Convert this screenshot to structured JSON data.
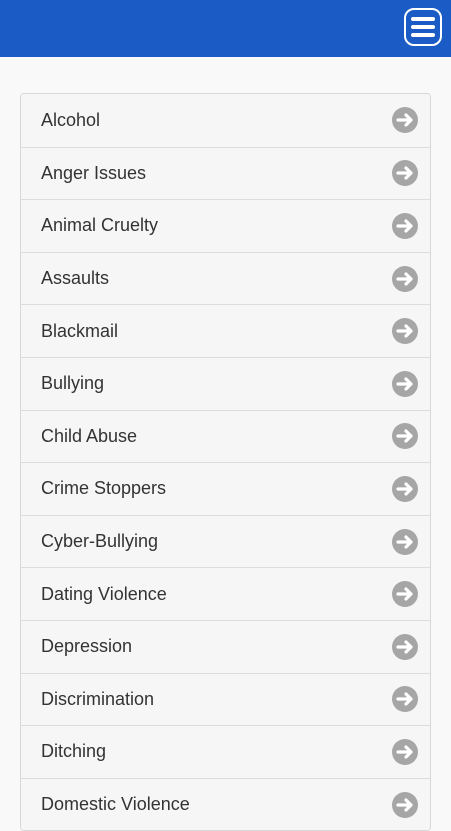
{
  "header": {
    "menu_icon": "hamburger-menu-icon",
    "background_color": "#1b5bc6"
  },
  "list": {
    "arrow_icon": "arrow-right-circle-icon",
    "arrow_color": "#a6a6a6",
    "items": [
      {
        "label": "Alcohol"
      },
      {
        "label": "Anger Issues"
      },
      {
        "label": "Animal Cruelty"
      },
      {
        "label": "Assaults"
      },
      {
        "label": "Blackmail"
      },
      {
        "label": "Bullying"
      },
      {
        "label": "Child Abuse"
      },
      {
        "label": "Crime Stoppers"
      },
      {
        "label": "Cyber-Bullying"
      },
      {
        "label": "Dating Violence"
      },
      {
        "label": "Depression"
      },
      {
        "label": "Discrimination"
      },
      {
        "label": "Ditching"
      },
      {
        "label": "Domestic Violence"
      }
    ]
  }
}
